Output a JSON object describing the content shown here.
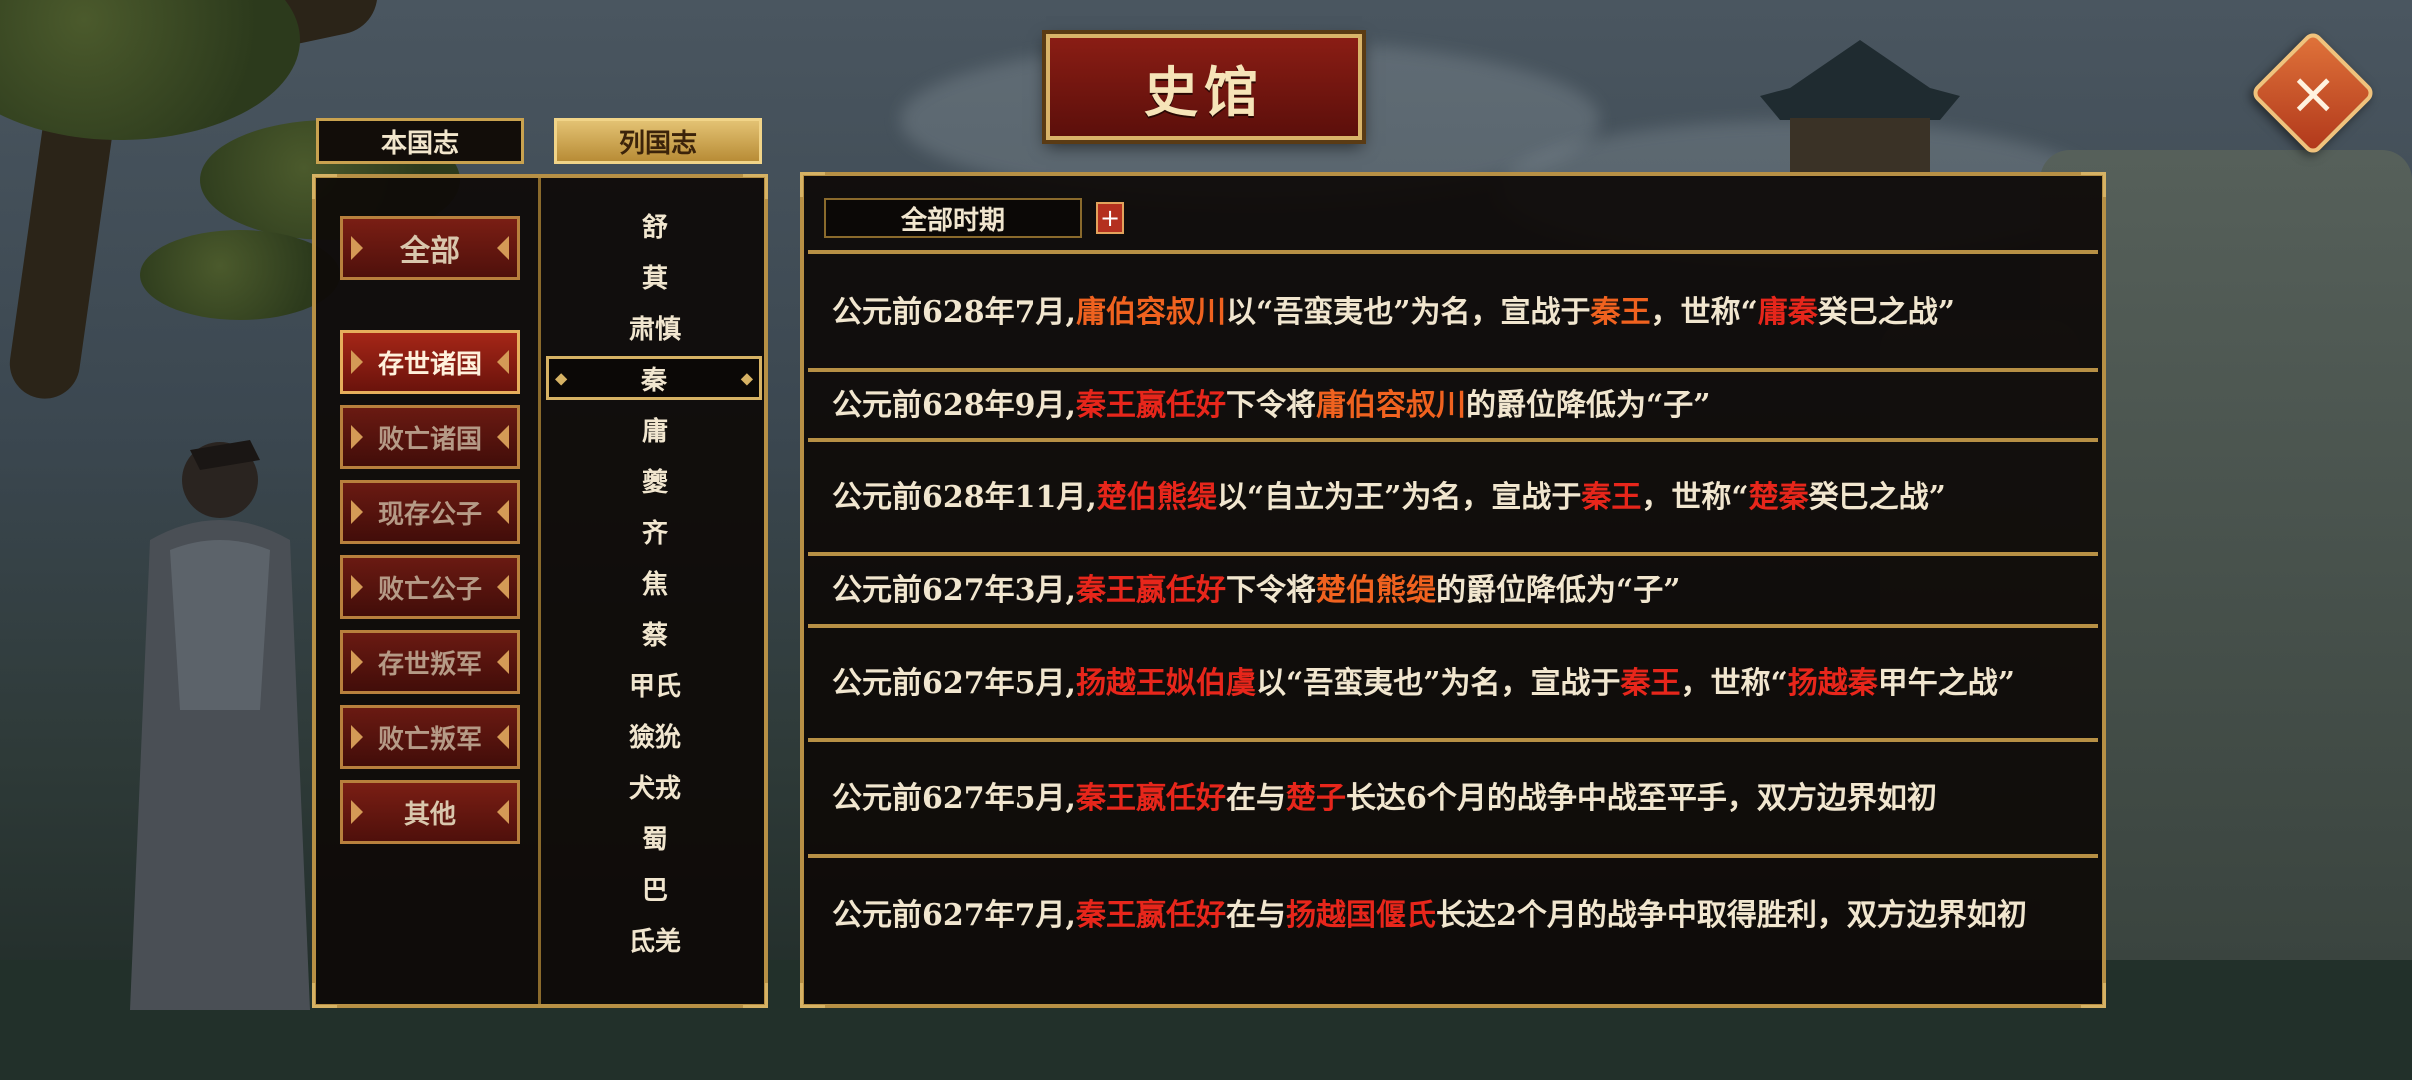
{
  "header": {
    "title": "史馆",
    "close_icon": "×"
  },
  "tabs": [
    {
      "label": "本国志",
      "active": false
    },
    {
      "label": "列国志",
      "active": true
    }
  ],
  "categories": [
    {
      "label": "全部",
      "state": "normal"
    },
    {
      "label": "存世诸国",
      "state": "active"
    },
    {
      "label": "败亡诸国",
      "state": "dim"
    },
    {
      "label": "现存公子",
      "state": "dim"
    },
    {
      "label": "败亡公子",
      "state": "dim"
    },
    {
      "label": "存世叛军",
      "state": "dim"
    },
    {
      "label": "败亡叛军",
      "state": "dim"
    },
    {
      "label": "其他",
      "state": "normal"
    }
  ],
  "nations": [
    "舒",
    "萁",
    "肃慎",
    "秦",
    "庸",
    "夔",
    "齐",
    "焦",
    "蔡",
    "甲氏",
    "獫狁",
    "犬戎",
    "蜀",
    "巴",
    "氐羌"
  ],
  "selected_nation": "秦",
  "filter": {
    "period": "全部时期",
    "plus": "+"
  },
  "colors": {
    "name_red": "#e7261b",
    "name_orange": "#f0621f",
    "gold_border": "#b79045",
    "panel_bg": "#0e0a07"
  },
  "entries": [
    {
      "parts": [
        {
          "t": "公元前628年7月,"
        },
        {
          "t": "庸伯容叔川",
          "c": "orange"
        },
        {
          "t": "以“吾蛮夷也”为名，宣战于"
        },
        {
          "t": "秦王",
          "c": "orange"
        },
        {
          "t": "，世称“"
        },
        {
          "t": "庸",
          "c": "red"
        },
        {
          "t": "秦",
          "c": "red"
        },
        {
          "t": "癸巳之战”"
        }
      ]
    },
    {
      "parts": [
        {
          "t": "公元前628年9月,"
        },
        {
          "t": "秦王嬴任好",
          "c": "red"
        },
        {
          "t": "下令将"
        },
        {
          "t": "庸伯容叔川",
          "c": "orange"
        },
        {
          "t": "的爵位降低为“子”"
        }
      ]
    },
    {
      "parts": [
        {
          "t": "公元前628年11月,"
        },
        {
          "t": "楚伯熊缇",
          "c": "red"
        },
        {
          "t": "以“自立为王”为名，宣战于"
        },
        {
          "t": "秦王",
          "c": "red"
        },
        {
          "t": "，世称“"
        },
        {
          "t": "楚",
          "c": "red"
        },
        {
          "t": "秦",
          "c": "red"
        },
        {
          "t": "癸巳之战”"
        }
      ]
    },
    {
      "parts": [
        {
          "t": "公元前627年3月,"
        },
        {
          "t": "秦王嬴任好",
          "c": "red"
        },
        {
          "t": "下令将"
        },
        {
          "t": "楚伯熊缇",
          "c": "orange"
        },
        {
          "t": "的爵位降低为“子”"
        }
      ]
    },
    {
      "parts": [
        {
          "t": "公元前627年5月,"
        },
        {
          "t": "扬越王姒伯虞",
          "c": "red"
        },
        {
          "t": "以“吾蛮夷也”为名，宣战于"
        },
        {
          "t": "秦王",
          "c": "red"
        },
        {
          "t": "，世称“"
        },
        {
          "t": "扬越",
          "c": "red"
        },
        {
          "t": "秦",
          "c": "red"
        },
        {
          "t": "甲午之战”"
        }
      ]
    },
    {
      "parts": [
        {
          "t": "公元前627年5月,"
        },
        {
          "t": "秦王嬴任好",
          "c": "red"
        },
        {
          "t": "在与"
        },
        {
          "t": "楚子",
          "c": "red"
        },
        {
          "t": "长达6个月的战争中战至平手，双方"
        },
        {
          "t": "边界如初"
        }
      ]
    },
    {
      "parts": [
        {
          "t": "公元前627年7月,"
        },
        {
          "t": "秦王嬴任好",
          "c": "red"
        },
        {
          "t": "在与"
        },
        {
          "t": "扬越国偃氏",
          "c": "red"
        },
        {
          "t": "长达2个月的战争中取得胜利"
        },
        {
          "t": "，双方边界如初"
        }
      ]
    }
  ]
}
